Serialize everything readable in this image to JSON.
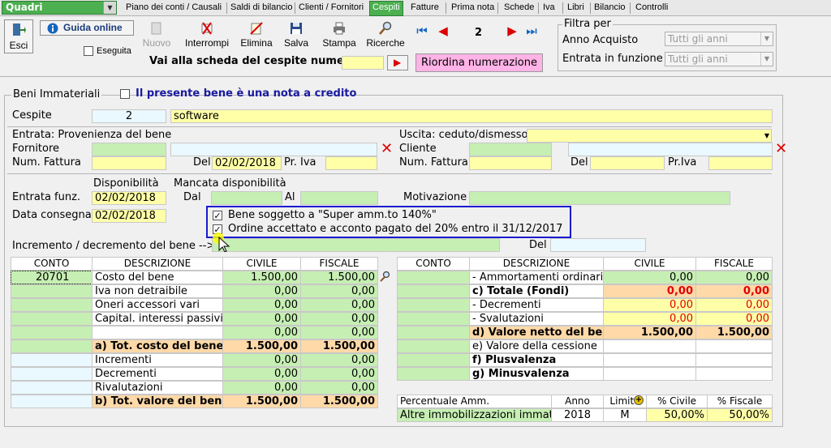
{
  "topbar": {
    "combo_value": "Quadri",
    "tabs": [
      "Piano dei conti / Causali",
      "Saldi di bilancio",
      "Clienti / Fornitori",
      "Cespiti",
      "Fatture",
      "Prima nota",
      "Schede",
      "Iva",
      "Libri",
      "Bilancio",
      "Controlli"
    ],
    "active_tab": "Cespiti"
  },
  "toolbar": {
    "esci": "Esci",
    "guida": "Guida online",
    "eseguita": "Eseguita",
    "nuovo": "Nuovo",
    "interrompi": "Interrompi",
    "elimina": "Elimina",
    "salva": "Salva",
    "stampa": "Stampa",
    "ricerche": "Ricerche",
    "record_number": "2",
    "vai_label": "Vai alla scheda del cespite numero:",
    "vai_value": "",
    "riordina": "Riordina numerazione"
  },
  "filter": {
    "title": "Filtra per",
    "anno_label": "Anno Acquisto",
    "anno_value": "Tutti gli anni",
    "entrata_label": "Entrata in funzione",
    "entrata_value": "Tutti gli anni"
  },
  "header": {
    "group": "Beni Immateriali",
    "nota_credito": "Il presente bene è una nota a credito",
    "cespite_label": "Cespite",
    "cespite_num": "2",
    "cespite_desc": "software"
  },
  "entrata": {
    "title": "Entrata: Provenienza del bene",
    "fornitore_label": "Fornitore",
    "fornitore_code": "",
    "fornitore_name": "",
    "num_fattura_label": "Num. Fattura",
    "num_fattura": "",
    "del_label": "Del",
    "del_value": "02/02/2018",
    "piva_label": "Pr. Iva",
    "piva": ""
  },
  "uscita": {
    "title": "Uscita: ceduto/dismesso",
    "value": "",
    "cliente_label": "Cliente",
    "cliente_code": "",
    "cliente_name": "",
    "num_fattura_label": "Num. Fattura",
    "num_fattura": "",
    "del_label": "Del",
    "del_value": "",
    "piva_label": "Pr.Iva",
    "piva": ""
  },
  "dates": {
    "disponibilita": "Disponibilità",
    "mancata": "Mancata disponibilità",
    "entrata_funz_label": "Entrata funz.",
    "entrata_funz": "02/02/2018",
    "dal_label": "Dal",
    "dal": "",
    "al_label": "Al",
    "al": "",
    "motivazione_label": "Motivazione",
    "motivazione": "",
    "data_consegna_label": "Data consegna",
    "data_consegna": "02/02/2018"
  },
  "checks": {
    "super_amm": "Bene soggetto a \"Super amm.to 140%\"",
    "ordine": "Ordine accettato e acconto pagato del 20% entro il 31/12/2017"
  },
  "incremento": {
    "label": "Incremento / decremento del bene -->",
    "value": "",
    "del_label": "Del",
    "del_value": ""
  },
  "left_table": {
    "headers": [
      "CONTO",
      "DESCRIZIONE",
      "CIVILE",
      "FISCALE"
    ],
    "rows": [
      {
        "conto": "20701",
        "desc": "Costo del bene",
        "civ": "1.500,00",
        "fis": "1.500,00"
      },
      {
        "conto": "",
        "desc": "Iva non detraibile",
        "civ": "0,00",
        "fis": "0,00"
      },
      {
        "conto": "",
        "desc": "Oneri accessori vari",
        "civ": "0,00",
        "fis": "0,00"
      },
      {
        "conto": "",
        "desc": "Capital. interessi passivi",
        "civ": "0,00",
        "fis": "0,00"
      },
      {
        "conto": "",
        "desc": "",
        "civ": "0,00",
        "fis": "0,00"
      },
      {
        "conto": "",
        "desc": "a) Tot. costo del bene",
        "civ": "1.500,00",
        "fis": "1.500,00"
      },
      {
        "conto": "",
        "desc": "Incrementi",
        "civ": "0,00",
        "fis": "0,00"
      },
      {
        "conto": "",
        "desc": "Decrementi",
        "civ": "0,00",
        "fis": "0,00"
      },
      {
        "conto": "",
        "desc": "Rivalutazioni",
        "civ": "0,00",
        "fis": "0,00"
      },
      {
        "conto": "",
        "desc": "b) Tot. valore del bene",
        "civ": "1.500,00",
        "fis": "1.500,00"
      }
    ]
  },
  "right_table": {
    "headers": [
      "CONTO",
      "DESCRIZIONE",
      "CIVILE",
      "FISCALE"
    ],
    "rows": [
      {
        "conto": "",
        "desc": "- Ammortamenti ordinari",
        "civ": "0,00",
        "fis": "0,00"
      },
      {
        "conto": "",
        "desc": "c) Totale (Fondi)",
        "civ": "0,00",
        "fis": "0,00"
      },
      {
        "conto": "",
        "desc": "- Decrementi",
        "civ": "0,00",
        "fis": "0,00"
      },
      {
        "conto": "",
        "desc": "- Svalutazioni",
        "civ": "0,00",
        "fis": "0,00"
      },
      {
        "conto": "",
        "desc": "d) Valore netto del bene",
        "civ": "1.500,00",
        "fis": "1.500,00"
      },
      {
        "conto": "",
        "desc": "e) Valore della cessione",
        "civ": "",
        "fis": ""
      },
      {
        "conto": "",
        "desc": "f) Plusvalenza",
        "civ": "",
        "fis": ""
      },
      {
        "conto": "",
        "desc": "g) Minusvalenza",
        "civ": "",
        "fis": ""
      }
    ]
  },
  "perc": {
    "headers": [
      "Percentuale Amm.",
      "Anno",
      "Limite",
      "% Civile",
      "% Fiscale"
    ],
    "row": {
      "desc": "Altre immobilizzazioni immater",
      "anno": "2018",
      "limite": "M",
      "civ": "50,00%",
      "fis": "50,00%"
    }
  }
}
